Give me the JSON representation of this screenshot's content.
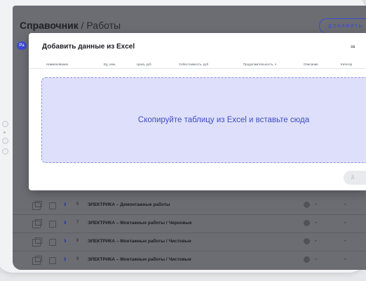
{
  "page": {
    "title_main": "Справочник",
    "title_separator": "/",
    "title_section": "Работы",
    "add_button": "ДОБАВИТЬ",
    "chip": "Ра"
  },
  "modal": {
    "title": "Добавить данные из Excel",
    "close_label": "за",
    "columns": [
      "Наименование",
      "Ед. изм.",
      "Цена, руб",
      "Себестоимость, руб",
      "Продолжительность, ч",
      "Описание",
      "Категор"
    ],
    "drop_text": "Скопируйте таблицу из Excel и вставьте сюда",
    "confirm_label": "Д"
  },
  "rows": [
    {
      "num": "6",
      "name": "ЭЛЕКТРИКА – Демонтажные работы",
      "col1": "-",
      "col2": "-"
    },
    {
      "num": "7",
      "name": "ЭЛЕКТРИКА – Монтажные работы / Черновые",
      "col1": "-",
      "col2": "-"
    },
    {
      "num": "8",
      "name": "ЭЛЕКТРИКА – Монтажные работы / Чистовые",
      "col1": "-",
      "col2": "-"
    },
    {
      "num": "9",
      "name": "ЭЛЕКТРИКА – Монтажные работы / Чистовые",
      "col1": "-",
      "col2": "-"
    }
  ]
}
